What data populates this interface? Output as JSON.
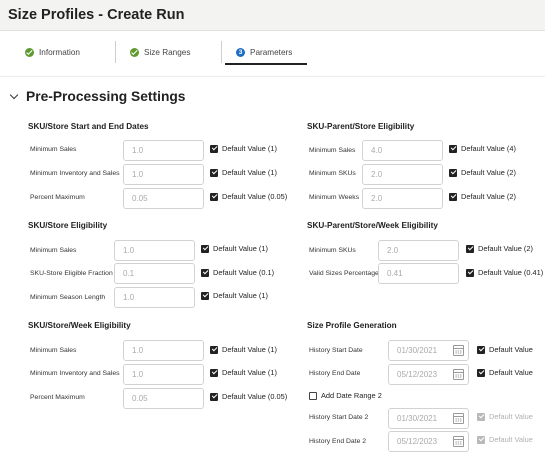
{
  "page": {
    "title": "Size Profiles - Create Run"
  },
  "tabs": [
    {
      "label": "Information",
      "state": "done"
    },
    {
      "label": "Size Ranges",
      "state": "done"
    },
    {
      "label": "Parameters",
      "state": "active",
      "step": "3"
    }
  ],
  "section": {
    "title": "Pre-Processing Settings"
  },
  "groups": {
    "sku_store_start_end": {
      "title": "SKU/Store Start and End Dates",
      "rows": [
        {
          "label": "Minimum Sales",
          "value": "1.0",
          "checkbox": "Default Value (1)"
        },
        {
          "label": "Minimum Inventory and Sales",
          "value": "1.0",
          "checkbox": "Default Value (1)"
        },
        {
          "label": "Percent Maximum",
          "value": "0.05",
          "checkbox": "Default Value (0.05)"
        }
      ]
    },
    "sku_store_elig": {
      "title": "SKU/Store Eligibility",
      "rows": [
        {
          "label": "Minimum Sales",
          "value": "1.0",
          "checkbox": "Default Value (1)"
        },
        {
          "label": "SKU-Store Eligible Fraction",
          "value": "0.1",
          "checkbox": "Default Value (0.1)"
        },
        {
          "label": "Minimum Season Length",
          "value": "1.0",
          "checkbox": "Default Value (1)"
        }
      ]
    },
    "sku_store_week_elig": {
      "title": "SKU/Store/Week Eligibility",
      "rows": [
        {
          "label": "Minimum Sales",
          "value": "1.0",
          "checkbox": "Default Value (1)"
        },
        {
          "label": "Minimum Inventory and Sales",
          "value": "1.0",
          "checkbox": "Default Value (1)"
        },
        {
          "label": "Percent Maximum",
          "value": "0.05",
          "checkbox": "Default Value (0.05)"
        }
      ]
    },
    "parent_store_elig": {
      "title": "SKU-Parent/Store Eligibility",
      "rows": [
        {
          "label": "Minimum Sales",
          "value": "4.0",
          "checkbox": "Default Value (4)"
        },
        {
          "label": "Minimum SKUs",
          "value": "2.0",
          "checkbox": "Default Value (2)"
        },
        {
          "label": "Minimum Weeks",
          "value": "2.0",
          "checkbox": "Default Value (2)"
        }
      ]
    },
    "parent_store_week_elig": {
      "title": "SKU-Parent/Store/Week Eligibility",
      "rows": [
        {
          "label": "Minimum SKUs",
          "value": "2.0",
          "checkbox": "Default Value (2)"
        },
        {
          "label": "Valid Sizes Percentage",
          "value": "0.41",
          "checkbox": "Default Value (0.41)"
        }
      ]
    },
    "size_profile_gen": {
      "title": "Size Profile Generation",
      "rows": [
        {
          "label": "History Start Date",
          "value": "01/30/2021",
          "checkbox": "Default Value"
        },
        {
          "label": "History End Date",
          "value": "05/12/2023",
          "checkbox": "Default Value"
        }
      ],
      "add_range_label": "Add Date Range 2",
      "rows2": [
        {
          "label": "History Start Date 2",
          "value": "01/30/2021",
          "checkbox": "Default Value"
        },
        {
          "label": "History End Date 2",
          "value": "05/12/2023",
          "checkbox": "Default Value"
        }
      ]
    }
  }
}
